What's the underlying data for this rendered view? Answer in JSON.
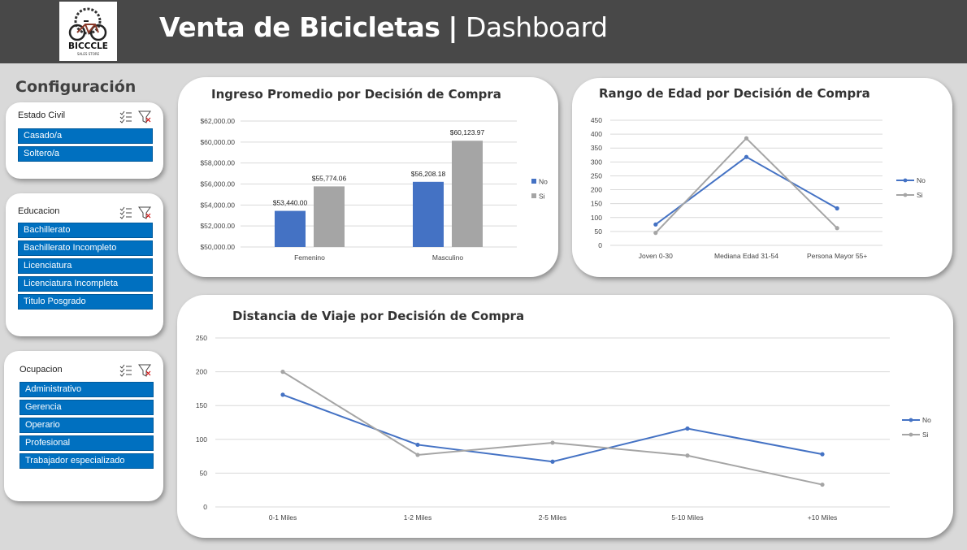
{
  "header": {
    "title_bold": "Venta de Bicicletas",
    "separator": "|",
    "title_light": "Dashboard",
    "logo": {
      "icon": "bicycle-logo-icon",
      "brand": "BICCCLE",
      "tagline": "SALES STORE"
    }
  },
  "config": {
    "title": "Configuración",
    "slicers": [
      {
        "title": "Estado Civil",
        "items": [
          "Casado/a",
          "Soltero/a"
        ]
      },
      {
        "title": "Educacion",
        "items": [
          "Bachillerato",
          "Bachillerato Incompleto",
          "Licenciatura",
          "Licenciatura Incompleta",
          "Titulo Posgrado"
        ]
      },
      {
        "title": "Ocupacion",
        "items": [
          "Administrativo",
          "Gerencia",
          "Operario",
          "Profesional",
          "Trabajador especializado"
        ]
      }
    ],
    "icons": {
      "multiselect": "multi-select-icon",
      "clear": "clear-filter-icon"
    }
  },
  "colors": {
    "no": "#4472c4",
    "si": "#a5a5a5",
    "slicer": "#0070c0",
    "header": "#484848"
  },
  "chart_data": [
    {
      "type": "bar",
      "title": "Ingreso Promedio por Decisión de Compra",
      "categories": [
        "Femenino",
        "Masculino"
      ],
      "series": [
        {
          "name": "No",
          "values": [
            53440.0,
            56208.18
          ],
          "labels": [
            "$53,440.00",
            "$56,208.18"
          ]
        },
        {
          "name": "Si",
          "values": [
            55774.06,
            60123.97
          ],
          "labels": [
            "$55,774.06",
            "$60,123.97"
          ]
        }
      ],
      "ylim": [
        50000,
        62000
      ],
      "yticks": [
        "$50,000.00",
        "$52,000.00",
        "$54,000.00",
        "$56,000.00",
        "$58,000.00",
        "$60,000.00",
        "$62,000.00"
      ],
      "legend": "right",
      "grid": true
    },
    {
      "type": "line",
      "title": "Rango de Edad por Decisión de Compra",
      "categories": [
        "Joven 0-30",
        "Mediana Edad 31-54",
        "Persona Mayor 55+"
      ],
      "series": [
        {
          "name": "No",
          "values": [
            75,
            318,
            133
          ]
        },
        {
          "name": "Si",
          "values": [
            45,
            385,
            62
          ]
        }
      ],
      "ylim": [
        0,
        450
      ],
      "yticks": [
        "0",
        "50",
        "100",
        "150",
        "200",
        "250",
        "300",
        "350",
        "400",
        "450"
      ],
      "legend": "right",
      "grid": true
    },
    {
      "type": "line",
      "title": "Distancia de Viaje por Decisión de Compra",
      "categories": [
        "0-1 Miles",
        "1-2 Miles",
        "2-5 Miles",
        "5-10 Miles",
        "+10 Miles"
      ],
      "series": [
        {
          "name": "No",
          "values": [
            166,
            92,
            67,
            116,
            78
          ]
        },
        {
          "name": "Si",
          "values": [
            200,
            77,
            95,
            76,
            33
          ]
        }
      ],
      "ylim": [
        0,
        250
      ],
      "yticks": [
        "0",
        "50",
        "100",
        "150",
        "200",
        "250"
      ],
      "legend": "right",
      "grid": true
    }
  ]
}
